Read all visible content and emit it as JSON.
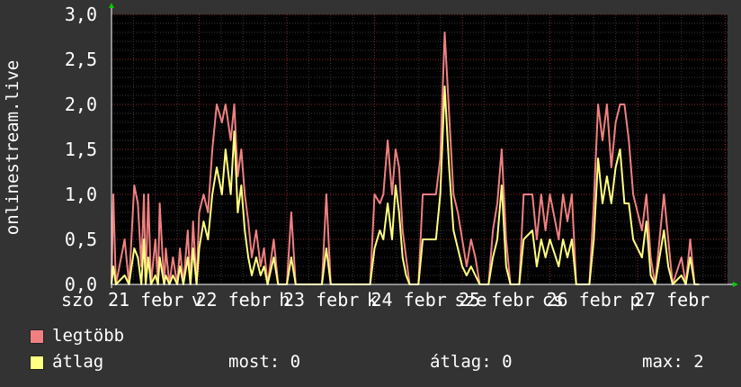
{
  "chart_data": {
    "type": "line",
    "ylabel": "onlinestream.live",
    "ylim": [
      0,
      3.0
    ],
    "yticks": [
      "0,0",
      "0,5",
      "1,0",
      "1,5",
      "2,0",
      "2,5",
      "3,0"
    ],
    "ytick_values": [
      0,
      0.5,
      1.0,
      1.5,
      2.0,
      2.5,
      3.0
    ],
    "xlim": [
      0,
      8.7
    ],
    "xticks": [
      {
        "pos": 0,
        "label": "szo"
      },
      {
        "pos": 0,
        "label": "21 febr"
      },
      {
        "pos": 0.85,
        "label": "v"
      },
      {
        "pos": 1.0,
        "label": "22 febr"
      },
      {
        "pos": 1.85,
        "label": "h"
      },
      {
        "pos": 2.0,
        "label": "23 febr"
      },
      {
        "pos": 2.85,
        "label": "k"
      },
      {
        "pos": 3.0,
        "label": "24 febr"
      },
      {
        "pos": 3.85,
        "label": "sze"
      },
      {
        "pos": 4.0,
        "label": "25 febr"
      },
      {
        "pos": 4.85,
        "label": "cs"
      },
      {
        "pos": 5.0,
        "label": "26 febr"
      },
      {
        "pos": 5.85,
        "label": "p"
      },
      {
        "pos": 6.0,
        "label": "27 febr"
      }
    ],
    "series": [
      {
        "name": "legtöbb",
        "color": "#f08080",
        "points": [
          [
            0,
            0
          ],
          [
            0.02,
            1.0
          ],
          [
            0.05,
            0
          ],
          [
            0.15,
            0.5
          ],
          [
            0.2,
            0
          ],
          [
            0.26,
            1.1
          ],
          [
            0.3,
            0.9
          ],
          [
            0.34,
            0.2
          ],
          [
            0.37,
            1.0
          ],
          [
            0.39,
            0
          ],
          [
            0.42,
            1.0
          ],
          [
            0.45,
            0
          ],
          [
            0.5,
            0.5
          ],
          [
            0.53,
            0
          ],
          [
            0.55,
            0.9
          ],
          [
            0.6,
            0
          ],
          [
            0.62,
            0.4
          ],
          [
            0.66,
            0
          ],
          [
            0.7,
            0.3
          ],
          [
            0.75,
            0
          ],
          [
            0.78,
            0.4
          ],
          [
            0.82,
            0
          ],
          [
            0.87,
            0.6
          ],
          [
            0.9,
            0
          ],
          [
            0.93,
            0.7
          ],
          [
            0.97,
            0
          ],
          [
            1.0,
            0.8
          ],
          [
            1.05,
            1.0
          ],
          [
            1.1,
            0.8
          ],
          [
            1.15,
            1.5
          ],
          [
            1.2,
            2.0
          ],
          [
            1.26,
            1.8
          ],
          [
            1.3,
            2.0
          ],
          [
            1.36,
            1.6
          ],
          [
            1.4,
            2.0
          ],
          [
            1.44,
            1.2
          ],
          [
            1.48,
            1.5
          ],
          [
            1.52,
            1.0
          ],
          [
            1.56,
            0.7
          ],
          [
            1.6,
            0.3
          ],
          [
            1.65,
            0.6
          ],
          [
            1.7,
            0.2
          ],
          [
            1.74,
            0.4
          ],
          [
            1.78,
            0
          ],
          [
            1.85,
            0.5
          ],
          [
            1.9,
            0
          ],
          [
            2.0,
            0
          ],
          [
            2.05,
            0.8
          ],
          [
            2.1,
            0
          ],
          [
            2.4,
            0
          ],
          [
            2.45,
            1.0
          ],
          [
            2.5,
            0
          ],
          [
            2.95,
            0
          ],
          [
            3.0,
            1.0
          ],
          [
            3.06,
            0.9
          ],
          [
            3.1,
            1.0
          ],
          [
            3.15,
            1.6
          ],
          [
            3.2,
            1.0
          ],
          [
            3.24,
            1.5
          ],
          [
            3.28,
            1.3
          ],
          [
            3.32,
            0.6
          ],
          [
            3.36,
            0.3
          ],
          [
            3.4,
            0
          ],
          [
            3.5,
            0
          ],
          [
            3.55,
            1.0
          ],
          [
            3.7,
            1.0
          ],
          [
            3.75,
            1.4
          ],
          [
            3.8,
            2.8
          ],
          [
            3.85,
            1.9
          ],
          [
            3.9,
            1.0
          ],
          [
            3.95,
            0.8
          ],
          [
            4.0,
            0.5
          ],
          [
            4.05,
            0.2
          ],
          [
            4.1,
            0.5
          ],
          [
            4.15,
            0.3
          ],
          [
            4.2,
            0
          ],
          [
            4.3,
            0
          ],
          [
            4.35,
            0.6
          ],
          [
            4.4,
            0.9
          ],
          [
            4.45,
            1.5
          ],
          [
            4.5,
            0.5
          ],
          [
            4.55,
            0
          ],
          [
            4.65,
            0
          ],
          [
            4.7,
            1.0
          ],
          [
            4.8,
            1.0
          ],
          [
            4.85,
            0.5
          ],
          [
            4.9,
            1.0
          ],
          [
            4.95,
            0.6
          ],
          [
            5.0,
            1.0
          ],
          [
            5.1,
            0.5
          ],
          [
            5.15,
            1.0
          ],
          [
            5.2,
            0.7
          ],
          [
            5.25,
            1.0
          ],
          [
            5.3,
            0
          ],
          [
            5.45,
            0
          ],
          [
            5.5,
            0.9
          ],
          [
            5.55,
            2.0
          ],
          [
            5.6,
            1.6
          ],
          [
            5.65,
            2.0
          ],
          [
            5.7,
            1.3
          ],
          [
            5.75,
            1.8
          ],
          [
            5.8,
            2.0
          ],
          [
            5.85,
            2.0
          ],
          [
            5.9,
            1.6
          ],
          [
            5.95,
            1.0
          ],
          [
            6.0,
            0.8
          ],
          [
            6.05,
            0.6
          ],
          [
            6.1,
            1.0
          ],
          [
            6.15,
            0.3
          ],
          [
            6.2,
            0
          ],
          [
            6.3,
            1.0
          ],
          [
            6.35,
            0.5
          ],
          [
            6.4,
            0
          ],
          [
            6.5,
            0.3
          ],
          [
            6.55,
            0
          ],
          [
            6.6,
            0.5
          ],
          [
            6.65,
            0
          ],
          [
            6.7,
            0
          ]
        ]
      },
      {
        "name": "átlag",
        "color": "#ffff80",
        "points": [
          [
            0,
            0
          ],
          [
            0.02,
            0.2
          ],
          [
            0.05,
            0
          ],
          [
            0.15,
            0.1
          ],
          [
            0.2,
            0
          ],
          [
            0.26,
            0.4
          ],
          [
            0.3,
            0.3
          ],
          [
            0.34,
            0
          ],
          [
            0.37,
            0.5
          ],
          [
            0.39,
            0
          ],
          [
            0.42,
            0.3
          ],
          [
            0.45,
            0
          ],
          [
            0.5,
            0.1
          ],
          [
            0.53,
            0
          ],
          [
            0.55,
            0.3
          ],
          [
            0.6,
            0
          ],
          [
            0.62,
            0.1
          ],
          [
            0.66,
            0
          ],
          [
            0.7,
            0.1
          ],
          [
            0.75,
            0
          ],
          [
            0.78,
            0.2
          ],
          [
            0.82,
            0
          ],
          [
            0.87,
            0.3
          ],
          [
            0.9,
            0
          ],
          [
            0.93,
            0.4
          ],
          [
            0.97,
            0
          ],
          [
            1.0,
            0.4
          ],
          [
            1.05,
            0.7
          ],
          [
            1.1,
            0.5
          ],
          [
            1.15,
            1.0
          ],
          [
            1.2,
            1.3
          ],
          [
            1.26,
            1.0
          ],
          [
            1.3,
            1.5
          ],
          [
            1.36,
            1.0
          ],
          [
            1.4,
            1.7
          ],
          [
            1.44,
            0.8
          ],
          [
            1.48,
            1.1
          ],
          [
            1.52,
            0.6
          ],
          [
            1.56,
            0.3
          ],
          [
            1.6,
            0.1
          ],
          [
            1.65,
            0.3
          ],
          [
            1.7,
            0.1
          ],
          [
            1.74,
            0.2
          ],
          [
            1.78,
            0
          ],
          [
            1.85,
            0.3
          ],
          [
            1.9,
            0
          ],
          [
            2.0,
            0
          ],
          [
            2.05,
            0.3
          ],
          [
            2.1,
            0
          ],
          [
            2.4,
            0
          ],
          [
            2.45,
            0.4
          ],
          [
            2.5,
            0
          ],
          [
            2.95,
            0
          ],
          [
            3.0,
            0.4
          ],
          [
            3.06,
            0.6
          ],
          [
            3.1,
            0.5
          ],
          [
            3.15,
            0.9
          ],
          [
            3.2,
            0.5
          ],
          [
            3.24,
            1.1
          ],
          [
            3.28,
            0.8
          ],
          [
            3.32,
            0.3
          ],
          [
            3.36,
            0.1
          ],
          [
            3.4,
            0
          ],
          [
            3.5,
            0
          ],
          [
            3.55,
            0.5
          ],
          [
            3.7,
            0.5
          ],
          [
            3.75,
            1.0
          ],
          [
            3.8,
            2.2
          ],
          [
            3.85,
            1.3
          ],
          [
            3.9,
            0.6
          ],
          [
            3.95,
            0.4
          ],
          [
            4.0,
            0.2
          ],
          [
            4.05,
            0.1
          ],
          [
            4.1,
            0.2
          ],
          [
            4.15,
            0.1
          ],
          [
            4.2,
            0
          ],
          [
            4.3,
            0
          ],
          [
            4.35,
            0.3
          ],
          [
            4.4,
            0.5
          ],
          [
            4.45,
            1.1
          ],
          [
            4.5,
            0.2
          ],
          [
            4.55,
            0
          ],
          [
            4.65,
            0
          ],
          [
            4.7,
            0.5
          ],
          [
            4.8,
            0.6
          ],
          [
            4.85,
            0.2
          ],
          [
            4.9,
            0.5
          ],
          [
            4.95,
            0.3
          ],
          [
            5.0,
            0.5
          ],
          [
            5.1,
            0.2
          ],
          [
            5.15,
            0.5
          ],
          [
            5.2,
            0.3
          ],
          [
            5.25,
            0.5
          ],
          [
            5.3,
            0
          ],
          [
            5.45,
            0
          ],
          [
            5.5,
            0.5
          ],
          [
            5.55,
            1.4
          ],
          [
            5.6,
            0.9
          ],
          [
            5.65,
            1.2
          ],
          [
            5.7,
            0.9
          ],
          [
            5.75,
            1.3
          ],
          [
            5.8,
            1.5
          ],
          [
            5.85,
            0.9
          ],
          [
            5.9,
            0.9
          ],
          [
            5.95,
            0.5
          ],
          [
            6.0,
            0.4
          ],
          [
            6.05,
            0.3
          ],
          [
            6.1,
            0.7
          ],
          [
            6.15,
            0.1
          ],
          [
            6.2,
            0
          ],
          [
            6.3,
            0.6
          ],
          [
            6.35,
            0.2
          ],
          [
            6.4,
            0
          ],
          [
            6.5,
            0.1
          ],
          [
            6.55,
            0
          ],
          [
            6.6,
            0.3
          ],
          [
            6.65,
            0
          ],
          [
            6.7,
            0
          ]
        ]
      }
    ]
  },
  "legend": {
    "max_label": "legtöbb",
    "avg_label": "átlag",
    "now_text": "most: 0",
    "avg_text": "átlag: 0",
    "max_text": "max: 2",
    "max_color": "#f08080",
    "avg_color": "#ffff80"
  }
}
